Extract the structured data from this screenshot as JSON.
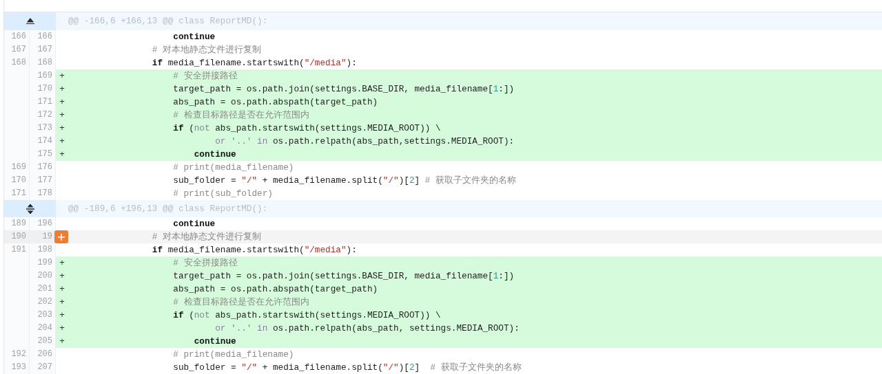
{
  "hunks": [
    {
      "header": "@@ -166,6 +166,13 @@ class ReportMD():",
      "kind": "up",
      "rows": [
        {
          "kind": "context",
          "old": "166",
          "new": "166",
          "hovered": false,
          "code": [
            {
              "kind": "keyword",
              "text": "                    continue"
            }
          ]
        },
        {
          "kind": "context",
          "old": "167",
          "new": "167",
          "hovered": false,
          "code": [
            {
              "kind": "comment",
              "text": "                # 对本地静态文件进行复制"
            }
          ]
        },
        {
          "kind": "context",
          "old": "168",
          "new": "168",
          "hovered": false,
          "code": [
            {
              "kind": "keyword",
              "text": "                if"
            },
            {
              "kind": "plain",
              "text": " media_filename.startswith("
            },
            {
              "kind": "string",
              "text": "\"/media\""
            },
            {
              "kind": "plain",
              "text": "):"
            }
          ]
        },
        {
          "kind": "add",
          "sign": "+",
          "new": "169",
          "hovered": false,
          "code": [
            {
              "kind": "comment",
              "text": "                    # 安全拼接路径"
            }
          ]
        },
        {
          "kind": "add",
          "sign": "+",
          "new": "170",
          "hovered": false,
          "code": [
            {
              "kind": "plain",
              "text": "                    target_path = os.path.join(settings.BASE_DIR, media_filename["
            },
            {
              "kind": "number",
              "text": "1"
            },
            {
              "kind": "plain",
              "text": ":])"
            }
          ]
        },
        {
          "kind": "add",
          "sign": "+",
          "new": "171",
          "hovered": false,
          "code": [
            {
              "kind": "plain",
              "text": "                    abs_path = os.path.abspath(target_path)"
            }
          ]
        },
        {
          "kind": "add",
          "sign": "+",
          "new": "172",
          "hovered": false,
          "code": [
            {
              "kind": "comment",
              "text": "                    # 检查目标路径是否在允许范围内"
            }
          ]
        },
        {
          "kind": "add",
          "sign": "+",
          "new": "173",
          "hovered": false,
          "code": [
            {
              "kind": "keyword",
              "text": "                    if"
            },
            {
              "kind": "plain",
              "text": " ("
            },
            {
              "kind": "operator",
              "text": "not"
            },
            {
              "kind": "plain",
              "text": " abs_path.startswith(settings.MEDIA_ROOT)) \\"
            }
          ]
        },
        {
          "kind": "add",
          "sign": "+",
          "new": "174",
          "hovered": false,
          "code": [
            {
              "kind": "operator",
              "text": "                            or '..' in"
            },
            {
              "kind": "plain",
              "text": " os.path.relpath(abs_path,settings.MEDIA_ROOT):"
            }
          ]
        },
        {
          "kind": "add",
          "sign": "+",
          "new": "175",
          "hovered": false,
          "code": [
            {
              "kind": "keyword",
              "text": "                        continue"
            }
          ]
        },
        {
          "kind": "context",
          "old": "169",
          "new": "176",
          "hovered": false,
          "code": [
            {
              "kind": "comment",
              "text": "                    # print(media_filename)"
            }
          ]
        },
        {
          "kind": "context",
          "old": "170",
          "new": "177",
          "hovered": false,
          "code": [
            {
              "kind": "plain",
              "text": "                    sub_folder = "
            },
            {
              "kind": "string",
              "text": "\"/\""
            },
            {
              "kind": "plain",
              "text": " + media_filename.split("
            },
            {
              "kind": "string",
              "text": "\"/\""
            },
            {
              "kind": "plain",
              "text": ")["
            },
            {
              "kind": "number",
              "text": "2"
            },
            {
              "kind": "plain",
              "text": "]"
            },
            {
              "kind": "comment",
              "text": " # 获取子文件夹的名称"
            }
          ]
        },
        {
          "kind": "context",
          "old": "171",
          "new": "178",
          "hovered": false,
          "code": [
            {
              "kind": "comment",
              "text": "                    # print(sub_folder)"
            }
          ]
        }
      ]
    },
    {
      "header": "@@ -189,6 +196,13 @@ class ReportMD():",
      "kind": "both",
      "rows": [
        {
          "kind": "context",
          "old": "189",
          "new": "196",
          "hovered": false,
          "code": [
            {
              "kind": "keyword",
              "text": "                    continue"
            }
          ]
        },
        {
          "kind": "context",
          "old": "190",
          "new": "19",
          "hovered": true,
          "code": [
            {
              "kind": "comment",
              "text": "                # 对本地静态文件进行复制"
            }
          ]
        },
        {
          "kind": "context",
          "old": "191",
          "new": "198",
          "hovered": false,
          "code": [
            {
              "kind": "keyword",
              "text": "                if"
            },
            {
              "kind": "plain",
              "text": " media_filename.startswith("
            },
            {
              "kind": "string",
              "text": "\"/media\""
            },
            {
              "kind": "plain",
              "text": "):"
            }
          ]
        },
        {
          "kind": "add",
          "sign": "+",
          "new": "199",
          "hovered": false,
          "code": [
            {
              "kind": "comment",
              "text": "                    # 安全拼接路径"
            }
          ]
        },
        {
          "kind": "add",
          "sign": "+",
          "new": "200",
          "hovered": false,
          "code": [
            {
              "kind": "plain",
              "text": "                    target_path = os.path.join(settings.BASE_DIR, media_filename["
            },
            {
              "kind": "number",
              "text": "1"
            },
            {
              "kind": "plain",
              "text": ":])"
            }
          ]
        },
        {
          "kind": "add",
          "sign": "+",
          "new": "201",
          "hovered": false,
          "code": [
            {
              "kind": "plain",
              "text": "                    abs_path = os.path.abspath(target_path)"
            }
          ]
        },
        {
          "kind": "add",
          "sign": "+",
          "new": "202",
          "hovered": false,
          "code": [
            {
              "kind": "comment",
              "text": "                    # 检查目标路径是否在允许范围内"
            }
          ]
        },
        {
          "kind": "add",
          "sign": "+",
          "new": "203",
          "hovered": false,
          "code": [
            {
              "kind": "keyword",
              "text": "                    if"
            },
            {
              "kind": "plain",
              "text": " ("
            },
            {
              "kind": "operator",
              "text": "not"
            },
            {
              "kind": "plain",
              "text": " abs_path.startswith(settings.MEDIA_ROOT)) \\"
            }
          ]
        },
        {
          "kind": "add",
          "sign": "+",
          "new": "204",
          "hovered": false,
          "code": [
            {
              "kind": "operator",
              "text": "                            or '..' in"
            },
            {
              "kind": "plain",
              "text": " os.path.relpath(abs_path, settings.MEDIA_ROOT):"
            }
          ]
        },
        {
          "kind": "add",
          "sign": "+",
          "new": "205",
          "hovered": false,
          "code": [
            {
              "kind": "keyword",
              "text": "                        continue"
            }
          ]
        },
        {
          "kind": "context",
          "old": "192",
          "new": "206",
          "hovered": false,
          "code": [
            {
              "kind": "comment",
              "text": "                    # print(media_filename)"
            }
          ]
        },
        {
          "kind": "context",
          "old": "193",
          "new": "207",
          "hovered": false,
          "code": [
            {
              "kind": "plain",
              "text": "                    sub_folder = "
            },
            {
              "kind": "string",
              "text": "\"/\""
            },
            {
              "kind": "plain",
              "text": " + media_filename.split("
            },
            {
              "kind": "string",
              "text": "\"/\""
            },
            {
              "kind": "plain",
              "text": ")["
            },
            {
              "kind": "number",
              "text": "2"
            },
            {
              "kind": "plain",
              "text": "]"
            },
            {
              "kind": "comment",
              "text": "  # 获取子文件夹的名称"
            }
          ]
        }
      ]
    }
  ]
}
